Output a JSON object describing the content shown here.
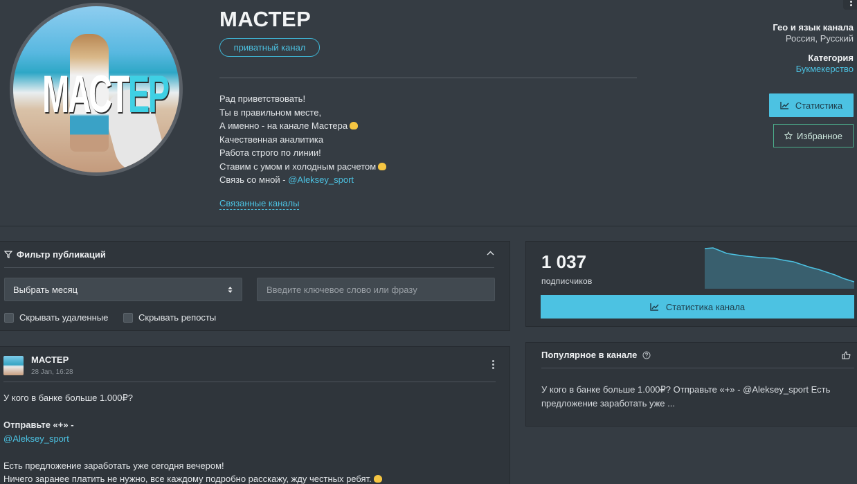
{
  "channel": {
    "title": "МАСТЕР",
    "avatar_text_main": "МАСТ",
    "avatar_text_accent": "ЕР",
    "private_badge": "приватный канал",
    "description": [
      "Рад приветствовать!",
      "Ты в правильном месте,",
      "А именно - на канале Мастера",
      "Качественная аналитика",
      "Работа строго по линии!",
      "Ставим с умом и холодным расчетом",
      "Связь со мной - "
    ],
    "contact_link": "@Aleksey_sport",
    "related_channels": "Связанные каналы",
    "geo_label": "Гео и язык канала",
    "geo_value": "Россия, Русский",
    "category_label": "Категория",
    "category_value": "Букмекерство",
    "stats_button": "Статистика",
    "favorite_button": "Избранное"
  },
  "filter": {
    "title": "Фильтр публикаций",
    "month_select": "Выбрать месяц",
    "search_placeholder": "Введите ключевое слово или фразу",
    "hide_deleted": "Скрывать удаленные",
    "hide_reposts": "Скрывать репосты"
  },
  "post": {
    "author": "МАСТЕР",
    "date": "28 Jan, 16:28",
    "line1": "У кого в банке больше 1.000₽?",
    "line2": "Отправьте «+» -",
    "link": "@Aleksey_sport",
    "line3": "Есть предложение заработать уже сегодня вечером!",
    "line4": "Ничего заранее платить не нужно, все каждому подробно расскажу, жду честных ребят."
  },
  "subscribers": {
    "count": "1 037",
    "label": "подписчиков",
    "button": "Статистика канала"
  },
  "popular": {
    "title": "Популярное в канале",
    "text": "У кого в банке больше 1.000₽? Отправьте «+» - @Aleksey_sport Есть предложение заработать уже ..."
  },
  "colors": {
    "accent": "#4cc2e2",
    "background": "#353c43",
    "panel": "#2f353b",
    "favorite_border": "#4caf8c"
  },
  "icons": [
    "filter-icon",
    "chevron-up-icon",
    "select-arrows-icon",
    "chart-icon",
    "star-icon",
    "help-icon",
    "thumbs-up-icon",
    "kebab-icon"
  ]
}
